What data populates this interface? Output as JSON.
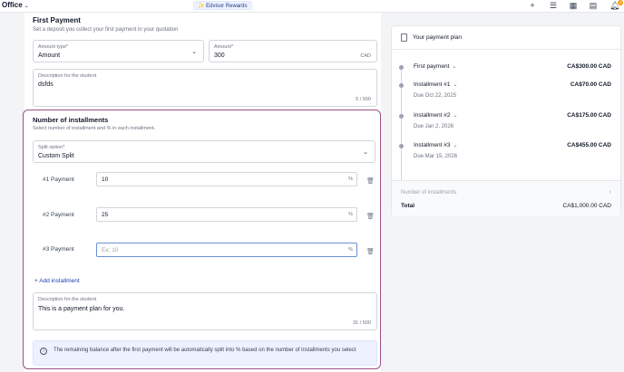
{
  "topbar": {
    "office_label": "Office",
    "rewards_label": "✨ Edvisor Rewards",
    "notification_count": "3"
  },
  "first_payment": {
    "title": "First Payment",
    "subtitle": "Set a deposit you collect your first payment in your quotation",
    "amount_type_label": "Amount type*",
    "amount_type_value": "Amount",
    "amount_label": "Amount*",
    "amount_value": "300",
    "amount_currency": "CAD",
    "description_label": "Description for the student",
    "description_value": "dsfds",
    "description_counter": "5 / 500"
  },
  "installments": {
    "title": "Number of installments",
    "subtitle": "Select number of installment and % in each installment.",
    "split_label": "Split option*",
    "split_value": "Custom Split",
    "rows": [
      {
        "label": "#1 Payment",
        "value": "10",
        "placeholder": "",
        "unit": "%"
      },
      {
        "label": "#2 Payment",
        "value": "25",
        "placeholder": "",
        "unit": "%"
      },
      {
        "label": "#3 Payment",
        "value": "",
        "placeholder": "Ex: 10",
        "unit": "%"
      }
    ],
    "add_label": "+ Add installment",
    "description_label": "Description for the student",
    "description_value": "This is a payment plan for you.",
    "description_counter": "31 / 500",
    "notice": "The remaining balance after the first payment will be automatically split into % based on the number of installments you select"
  },
  "plan": {
    "title": "Your payment plan",
    "items": [
      {
        "name": "First payment",
        "amount": "CA$300.00 CAD",
        "due": ""
      },
      {
        "name": "Installment #1",
        "amount": "CA$70.00 CAD",
        "due": "Due Oct 22, 2025"
      },
      {
        "name": "Installment #2",
        "amount": "CA$175.00 CAD",
        "due": "Due Jan 2, 2026"
      },
      {
        "name": "Installment #3",
        "amount": "CA$455.00 CAD",
        "due": "Due Mar 15, 2026"
      }
    ],
    "installments_label": "Number of installments",
    "total_label": "Total",
    "total_value": "CA$1,000.00 CAD"
  }
}
